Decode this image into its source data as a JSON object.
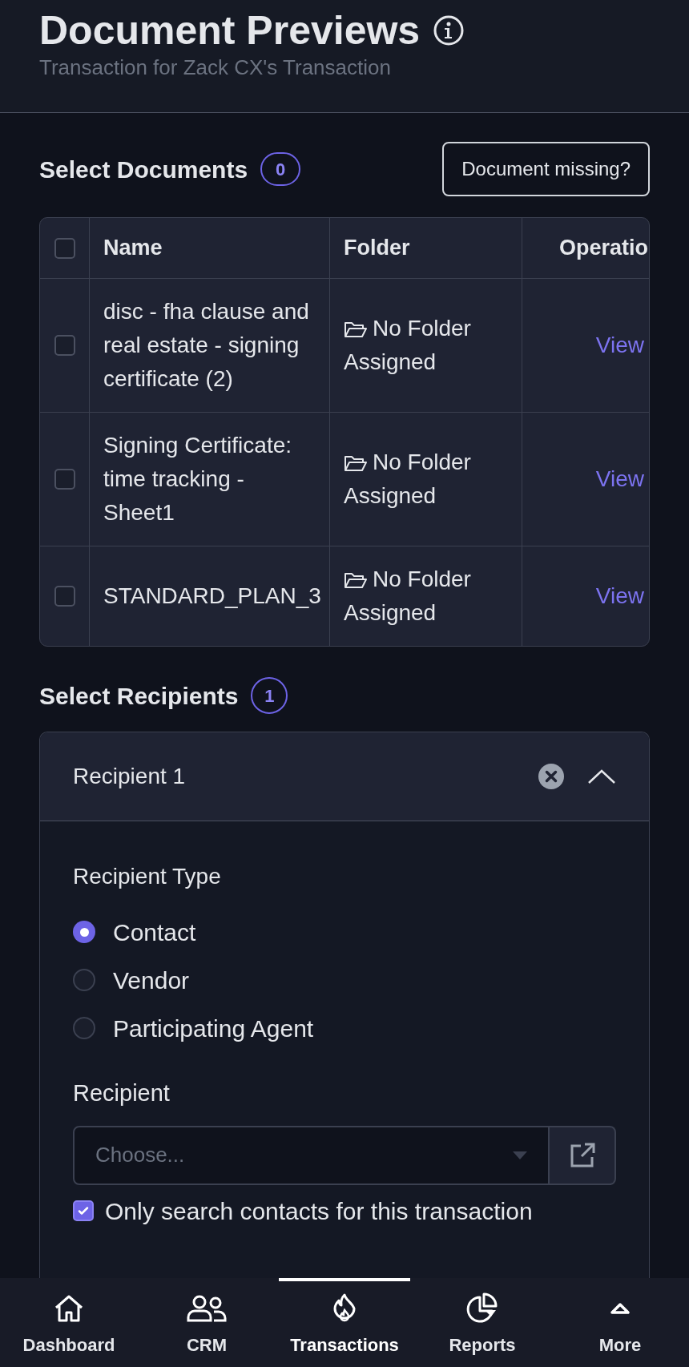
{
  "header": {
    "title": "Document Previews",
    "subtitle": "Transaction for Zack CX's Transaction"
  },
  "documents": {
    "heading": "Select Documents",
    "count": "0",
    "missing_button": "Document missing?",
    "select_all_checked": false,
    "columns": [
      "Name",
      "Folder",
      "Operatio"
    ],
    "rows": [
      {
        "name": "disc - fha clause and real estate - signing certificate (2)",
        "folder": "No Folder Assigned",
        "action": "View",
        "checked": false
      },
      {
        "name": "Signing Certificate: time tracking - Sheet1",
        "folder": "No Folder Assigned",
        "action": "View",
        "checked": false
      },
      {
        "name": "STANDARD_PLAN_3",
        "folder": "No Folder Assigned",
        "action": "View",
        "checked": false
      }
    ]
  },
  "recipients": {
    "heading": "Select Recipients",
    "count": "1",
    "items": [
      {
        "title": "Recipient 1",
        "expanded": true,
        "type_label": "Recipient Type",
        "types": [
          {
            "label": "Contact",
            "selected": true
          },
          {
            "label": "Vendor",
            "selected": false
          },
          {
            "label": "Participating Agent",
            "selected": false
          }
        ],
        "recipient_label": "Recipient",
        "recipient_placeholder": "Choose...",
        "only_transaction_label": "Only search contacts for this transaction",
        "only_transaction_checked": true
      }
    ]
  },
  "nav": [
    {
      "label": "Dashboard",
      "selected": false
    },
    {
      "label": "CRM",
      "selected": false
    },
    {
      "label": "Transactions",
      "selected": true
    },
    {
      "label": "Reports",
      "selected": false
    },
    {
      "label": "More",
      "selected": false
    }
  ]
}
